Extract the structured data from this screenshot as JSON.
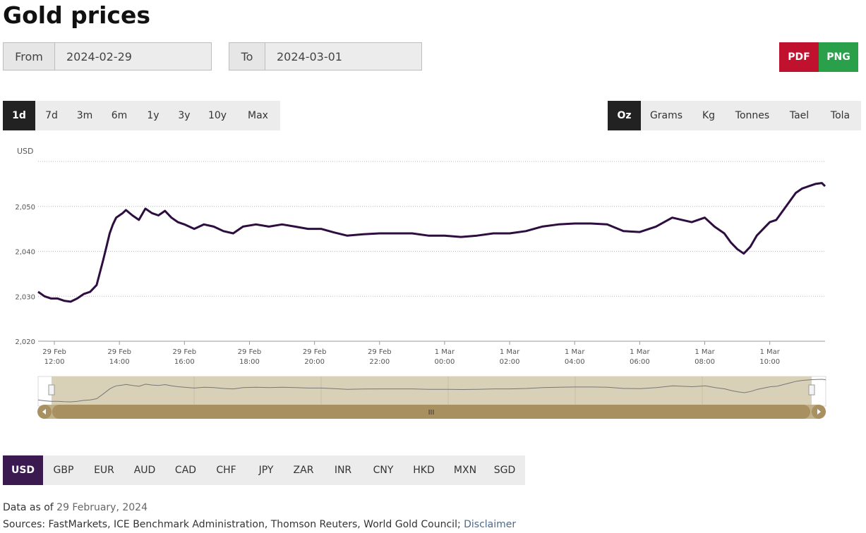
{
  "title": "Gold prices",
  "date_range": {
    "from_label": "From",
    "from_value": "2024-02-29",
    "to_label": "To",
    "to_value": "2024-03-01"
  },
  "export": {
    "pdf": "PDF",
    "png": "PNG",
    "pdf_color": "#c0112e",
    "png_color": "#2ba04a"
  },
  "periods": [
    "1d",
    "7d",
    "3m",
    "6m",
    "1y",
    "3y",
    "10y",
    "Max"
  ],
  "active_period": "1d",
  "units": [
    "Oz",
    "Grams",
    "Kg",
    "Tonnes",
    "Tael",
    "Tola"
  ],
  "active_unit": "Oz",
  "currencies": [
    "USD",
    "GBP",
    "EUR",
    "AUD",
    "CAD",
    "CHF",
    "JPY",
    "ZAR",
    "INR",
    "CNY",
    "HKD",
    "MXN",
    "SGD"
  ],
  "active_currency": "USD",
  "navigator": {
    "handle_label": "III"
  },
  "footer": {
    "data_as_of_label": "Data as of",
    "data_as_of_date": "29 February, 2024",
    "sources": "Sources: FastMarkets, ICE Benchmark Administration, Thomson Reuters, World Gold Council;",
    "disclaimer": "Disclaimer"
  },
  "chart_data": {
    "type": "line",
    "ylabel": "USD",
    "ylim": [
      2020,
      2060
    ],
    "yticks": [
      2020,
      2030,
      2040,
      2050
    ],
    "ytick_labels": [
      "2,020",
      "2,030",
      "2,040",
      "2,050"
    ],
    "xlim": [
      11.5,
      35.7
    ],
    "xticks": [
      {
        "h": 12,
        "l1": "29 Feb",
        "l2": "12:00"
      },
      {
        "h": 14,
        "l1": "29 Feb",
        "l2": "14:00"
      },
      {
        "h": 16,
        "l1": "29 Feb",
        "l2": "16:00"
      },
      {
        "h": 18,
        "l1": "29 Feb",
        "l2": "18:00"
      },
      {
        "h": 20,
        "l1": "29 Feb",
        "l2": "20:00"
      },
      {
        "h": 22,
        "l1": "29 Feb",
        "l2": "22:00"
      },
      {
        "h": 24,
        "l1": "1 Mar",
        "l2": "00:00"
      },
      {
        "h": 26,
        "l1": "1 Mar",
        "l2": "02:00"
      },
      {
        "h": 28,
        "l1": "1 Mar",
        "l2": "04:00"
      },
      {
        "h": 30,
        "l1": "1 Mar",
        "l2": "06:00"
      },
      {
        "h": 32,
        "l1": "1 Mar",
        "l2": "08:00"
      },
      {
        "h": 34,
        "l1": "1 Mar",
        "l2": "10:00"
      }
    ],
    "line_color": "#2e0d40",
    "x": [
      11.5,
      11.7,
      11.9,
      12.1,
      12.3,
      12.5,
      12.7,
      12.9,
      13.1,
      13.3,
      13.5,
      13.6,
      13.7,
      13.8,
      13.9,
      14.0,
      14.1,
      14.2,
      14.4,
      14.6,
      14.8,
      15.0,
      15.2,
      15.4,
      15.6,
      15.8,
      16.0,
      16.3,
      16.6,
      16.9,
      17.2,
      17.5,
      17.8,
      18.2,
      18.6,
      19.0,
      19.4,
      19.8,
      20.2,
      20.6,
      21.0,
      21.5,
      22.0,
      22.5,
      23.0,
      23.5,
      24.0,
      24.5,
      25.0,
      25.5,
      26.0,
      26.5,
      27.0,
      27.5,
      28.0,
      28.5,
      29.0,
      29.5,
      30.0,
      30.5,
      31.0,
      31.3,
      31.6,
      32.0,
      32.3,
      32.6,
      32.8,
      33.0,
      33.2,
      33.4,
      33.6,
      33.8,
      34.0,
      34.2,
      34.4,
      34.6,
      34.8,
      35.0,
      35.2,
      35.4,
      35.6,
      35.7
    ],
    "y": [
      2031,
      2030,
      2029.5,
      2029.5,
      2029,
      2028.8,
      2029.5,
      2030.5,
      2031,
      2032.5,
      2038,
      2041,
      2044,
      2046,
      2047.5,
      2048,
      2048.5,
      2049.2,
      2048,
      2047,
      2049.5,
      2048.5,
      2048,
      2049,
      2047.5,
      2046.5,
      2046,
      2045,
      2046,
      2045.5,
      2044.5,
      2044,
      2045.5,
      2046,
      2045.5,
      2046,
      2045.5,
      2045,
      2045,
      2044.2,
      2043.5,
      2043.8,
      2044,
      2044,
      2044,
      2043.5,
      2043.5,
      2043.2,
      2043.5,
      2044,
      2044,
      2044.5,
      2045.5,
      2046,
      2046.2,
      2046.2,
      2046,
      2044.5,
      2044.3,
      2045.5,
      2047.5,
      2047,
      2046.5,
      2047.5,
      2045.5,
      2044,
      2042,
      2040.5,
      2039.5,
      2041,
      2043.5,
      2045,
      2046.5,
      2047,
      2049,
      2051,
      2053,
      2054,
      2054.5,
      2055,
      2055.2,
      2054.5
    ]
  }
}
